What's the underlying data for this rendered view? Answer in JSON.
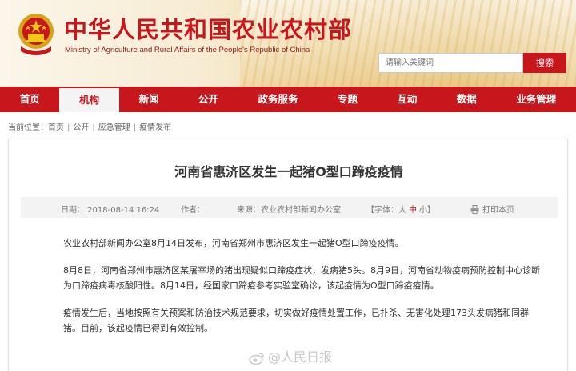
{
  "header": {
    "title": "中华人民共和国农业农村部",
    "subtitle": "Ministry of Agriculture and Rural Affairs of the People's Republic of China",
    "search_placeholder": "请输入关键词",
    "search_button": "搜索",
    "colors": {
      "brand_red": "#c8161d"
    }
  },
  "nav": {
    "items": [
      "首页",
      "机构",
      "新闻",
      "公开",
      "政务服务",
      "专题",
      "互动",
      "数据",
      "业务管理"
    ],
    "active": "机构"
  },
  "breadcrumb": {
    "prefix": "当前位置：",
    "items": [
      "首页",
      "公开",
      "应急管理",
      "疫情发布"
    ],
    "separator": "|"
  },
  "article": {
    "title": "河南省惠济区发生一起猪O型口蹄疫疫情",
    "date": "日期：  2018-08-14 16:24",
    "author": "作者：",
    "source": "来源：农业农村部新闻办公室",
    "font_label": "【字体：",
    "font_big": "大",
    "font_mid": "中",
    "font_small": "小",
    "font_end": "】",
    "print": "打印本页",
    "paragraphs": [
      "农业农村部新闻办公室8月14日发布，河南省郑州市惠济区发生一起猪O型口蹄疫疫情。",
      "8月8日，河南省郑州市惠济区某屠宰场的猪出现疑似口蹄疫症状，发病猪5头。8月9日，河南省动物疫病预防控制中心诊断为口蹄疫病毒核酸阳性。8月14日，经国家口蹄疫参考实验室确诊，该起疫情为O型口蹄疫疫情。",
      "疫情发生后，当地按照有关预案和防治技术规范要求，切实做好疫情处置工作，已扑杀、无害化处理173头发病猪和同群猪。目前，该起疫情已得到有效控制。"
    ],
    "watermark": "@人民日报"
  }
}
